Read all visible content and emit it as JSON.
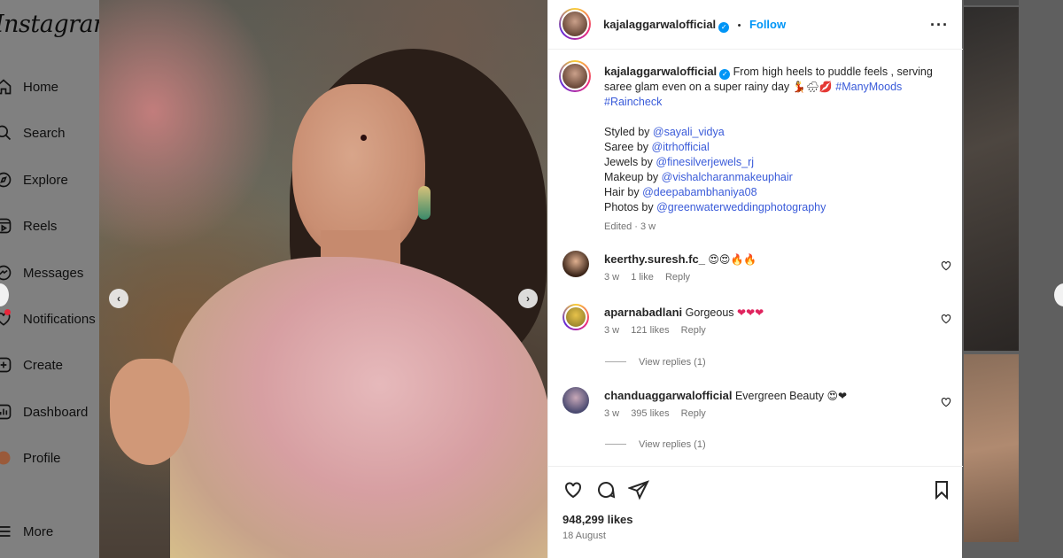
{
  "sidebar": {
    "logo": "Instagram",
    "items": [
      {
        "label": "Home",
        "icon": "home-icon"
      },
      {
        "label": "Search",
        "icon": "search-icon"
      },
      {
        "label": "Explore",
        "icon": "compass-icon"
      },
      {
        "label": "Reels",
        "icon": "reels-icon"
      },
      {
        "label": "Messages",
        "icon": "messenger-icon"
      },
      {
        "label": "Notifications",
        "icon": "heart-icon"
      },
      {
        "label": "Create",
        "icon": "plus-square-icon"
      },
      {
        "label": "Dashboard",
        "icon": "dashboard-icon"
      },
      {
        "label": "Profile",
        "icon": "profile-icon"
      },
      {
        "label": "More",
        "icon": "menu-icon"
      }
    ]
  },
  "post": {
    "header": {
      "username": "kajalaggarwalofficial",
      "separator": "•",
      "follow_label": "Follow"
    },
    "caption": {
      "username": "kajalaggarwalofficial",
      "text": "From high heels to puddle feels , serving saree glam even on a super rainy day",
      "emojis": "💃🌧💋",
      "hashtags": [
        "#ManyMoods",
        "#Raincheck"
      ],
      "credits": [
        {
          "role": "Styled by",
          "handle": "@sayali_vidya"
        },
        {
          "role": "Saree by",
          "handle": "@itrhofficial"
        },
        {
          "role": "Jewels by",
          "handle": "@finesilverjewels_rj"
        },
        {
          "role": "Makeup by",
          "handle": "@vishalcharanmakeuphair"
        },
        {
          "role": "Hair by",
          "handle": "@deepabambhaniya08"
        },
        {
          "role": "Photos by",
          "handle": "@greenwaterweddingphotography"
        }
      ],
      "edited": "Edited · 3 w"
    },
    "comments": [
      {
        "username": "keerthy.suresh.fc_",
        "text": "",
        "emojis": "😍😍🔥🔥",
        "time": "3 w",
        "likes": "1 like",
        "reply": "Reply",
        "view_replies": ""
      },
      {
        "username": "aparnabadlani",
        "text": "Gorgeous",
        "emojis": "❤❤❤",
        "time": "3 w",
        "likes": "121 likes",
        "reply": "Reply",
        "view_replies": "View replies (1)"
      },
      {
        "username": "chanduaggarwalofficial",
        "text": "Evergreen Beauty",
        "emojis": "😍❤",
        "time": "3 w",
        "likes": "395 likes",
        "reply": "Reply",
        "view_replies": "View replies (1)"
      }
    ],
    "likes": "948,299 likes",
    "date": "18 August"
  },
  "colors": {
    "link_blue": "#0095f6",
    "hashtag": "#3a5bd9",
    "muted": "#737373"
  }
}
